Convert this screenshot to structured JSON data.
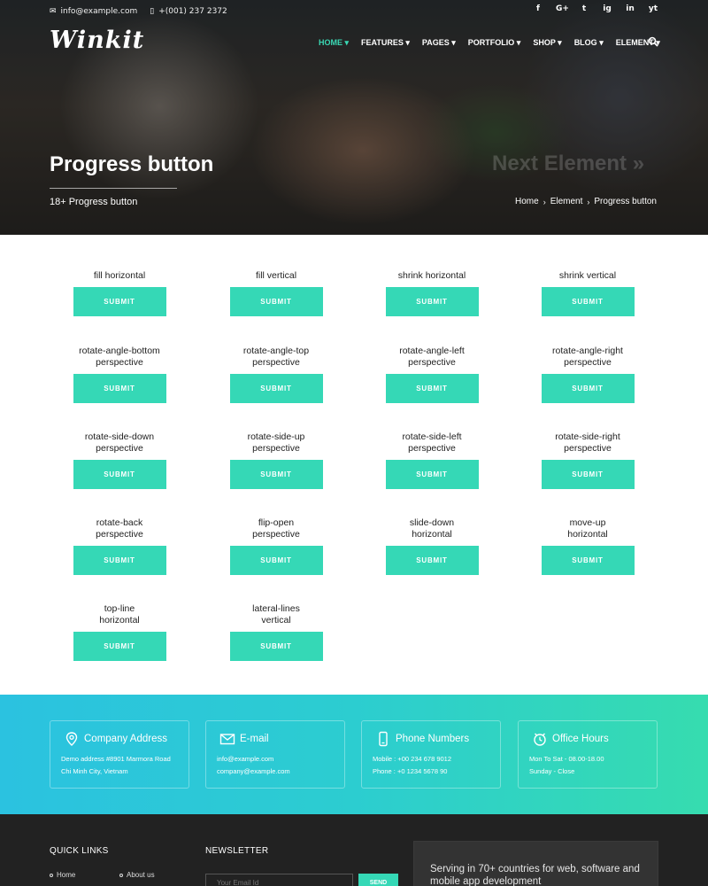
{
  "topbar": {
    "email": "info@example.com",
    "phone": "+(001) 237 2372",
    "socials": [
      "f",
      "G+",
      "t",
      "ig",
      "in",
      "yt"
    ]
  },
  "brand": {
    "logo_text": "Winkit"
  },
  "nav": {
    "items": [
      "HOME",
      "FEATURES",
      "PAGES",
      "PORTFOLIO",
      "SHOP",
      "BLOG",
      "ELEMENT"
    ],
    "active": "HOME",
    "accent_color": "#3ad8b4",
    "search_icon": "search-icon"
  },
  "hero": {
    "title": "Progress button",
    "subtitle": "18+ Progress button",
    "next_label": "Next Element »",
    "breadcrumb": [
      "Home",
      "Element",
      "Progress button"
    ]
  },
  "buttons": {
    "submit_label": "SUBMIT",
    "color": "#35d8b6",
    "items": [
      "fill horizontal",
      "fill vertical",
      "shrink horizontal",
      "shrink vertical",
      "rotate-angle-bottom\nperspective",
      "rotate-angle-top\nperspective",
      "rotate-angle-left\nperspective",
      "rotate-angle-right\nperspective",
      "rotate-side-down\nperspective",
      "rotate-side-up\nperspective",
      "rotate-side-left\nperspective",
      "rotate-side-right\nperspective",
      "rotate-back\nperspective",
      "flip-open\nperspective",
      "slide-down\nhorizontal",
      "move-up\nhorizontal",
      "top-line\nhorizontal",
      "lateral-lines\nvertical"
    ]
  },
  "contact": {
    "cards": [
      {
        "icon": "map-pin-icon",
        "title": "Company Address",
        "lines": [
          "Demo address #8901 Marmora Road",
          "Chi Minh City, Vietnam"
        ]
      },
      {
        "icon": "envelope-icon",
        "title": "E-mail",
        "lines": [
          "info@example.com",
          "company@example.com"
        ]
      },
      {
        "icon": "phone-icon",
        "title": "Phone Numbers",
        "lines": [
          "Mobile : +00 234 678 9012",
          "Phone : +0 1234 5678 90"
        ]
      },
      {
        "icon": "clock-icon",
        "title": "Office Hours",
        "lines": [
          "Mon To Sat - 08.00-18.00",
          "Sunday - Close"
        ]
      }
    ]
  },
  "footer": {
    "quick_links_title": "QUICK LINKS",
    "quick_links": [
      "Home",
      "About us"
    ],
    "newsletter_title": "NEWSLETTER",
    "newsletter_placeholder": "Your Email Id",
    "send_label": "SEND",
    "tagline": "Serving in 70+ countries for web, software and mobile app development"
  }
}
